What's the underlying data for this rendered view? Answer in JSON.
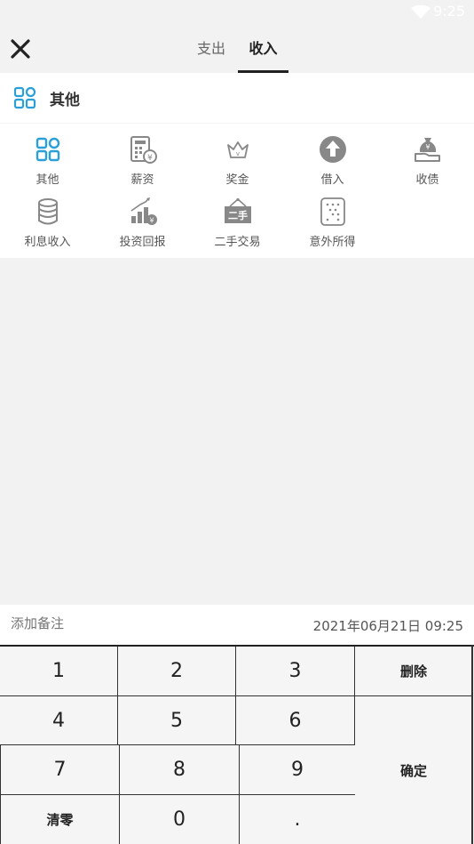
{
  "status": {
    "time": "9:25"
  },
  "header": {
    "tabs": [
      {
        "label": "支出",
        "active": false
      },
      {
        "label": "收入",
        "active": true
      }
    ]
  },
  "selected_category": {
    "label": "其他",
    "icon": "grid-icon"
  },
  "categories": [
    {
      "label": "其他",
      "icon": "grid-icon"
    },
    {
      "label": "薪资",
      "icon": "calculator-yen-icon"
    },
    {
      "label": "奖金",
      "icon": "crown-icon"
    },
    {
      "label": "借入",
      "icon": "arrow-up-circle-icon"
    },
    {
      "label": "收债",
      "icon": "money-bag-hand-icon"
    },
    {
      "label": "利息收入",
      "icon": "coin-stack-icon"
    },
    {
      "label": "投资回报",
      "icon": "growth-chart-icon"
    },
    {
      "label": "二手交易",
      "icon": "secondhand-sign-icon"
    },
    {
      "label": "意外所得",
      "icon": "dice-icon"
    }
  ],
  "remark": {
    "placeholder": "添加备注",
    "datetime": "2021年06月21日 09:25"
  },
  "keypad": {
    "k1": "1",
    "k2": "2",
    "k3": "3",
    "delete": "删除",
    "k4": "4",
    "k5": "5",
    "k6": "6",
    "k7": "7",
    "k8": "8",
    "k9": "9",
    "confirm": "确定",
    "clear": "清零",
    "k0": "0",
    "dot": "."
  },
  "colors": {
    "accent": "#2a9fd8",
    "icon_gray": "#888888",
    "background": "#f2f2f2"
  }
}
